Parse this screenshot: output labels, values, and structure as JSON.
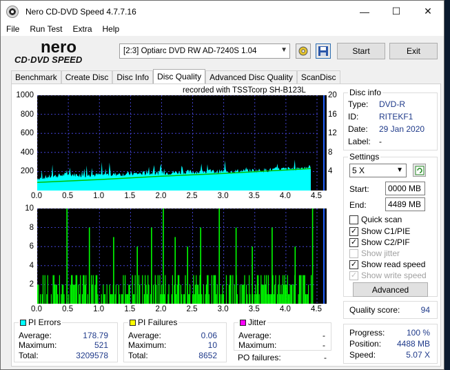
{
  "window": {
    "title": "Nero CD-DVD Speed 4.7.7.16"
  },
  "menu": [
    "File",
    "Run Test",
    "Extra",
    "Help"
  ],
  "toolbar": {
    "drive": "[2:3]  Optiarc DVD RW AD-7240S 1.04",
    "start_label": "Start",
    "exit_label": "Exit"
  },
  "tabs": [
    "Benchmark",
    "Create Disc",
    "Disc Info",
    "Disc Quality",
    "Advanced Disc Quality",
    "ScanDisc"
  ],
  "active_tab": "Disc Quality",
  "chart_top": {
    "caption": "recorded with TSSTcorp SH-B123L",
    "y_ticks": [
      "1000",
      "800",
      "600",
      "400",
      "200"
    ],
    "y2_ticks": [
      "20",
      "16",
      "12",
      "8",
      "4"
    ],
    "x_ticks": [
      "0.0",
      "0.5",
      "1.0",
      "1.5",
      "2.0",
      "2.5",
      "3.0",
      "3.5",
      "4.0",
      "4.5"
    ]
  },
  "chart_bottom": {
    "y_ticks": [
      "10",
      "8",
      "6",
      "4",
      "2"
    ],
    "x_ticks": [
      "0.0",
      "0.5",
      "1.0",
      "1.5",
      "2.0",
      "2.5",
      "3.0",
      "3.5",
      "4.0",
      "4.5"
    ]
  },
  "chart_data": [
    {
      "type": "area",
      "title": "recorded with TSSTcorp SH-B123L",
      "xlabel": "",
      "ylabel": "",
      "xlim": [
        0,
        4.5
      ],
      "ylim": [
        0,
        1000
      ],
      "y2lim": [
        0,
        20
      ],
      "series": [
        {
          "name": "PI Errors",
          "color": "#00ffff",
          "x": [
            0.0,
            0.25,
            0.5,
            0.75,
            1.0,
            1.5,
            2.0,
            2.5,
            3.0,
            3.5,
            4.0,
            4.3,
            4.4
          ],
          "values": [
            130,
            150,
            170,
            160,
            165,
            175,
            185,
            195,
            200,
            210,
            225,
            240,
            250
          ]
        },
        {
          "name": "Read speed",
          "color": "#00c000",
          "x": [
            0.0,
            1.0,
            2.0,
            3.0,
            4.0,
            4.4
          ],
          "values": [
            1.7,
            2.3,
            3.0,
            3.6,
            4.3,
            4.6
          ]
        }
      ]
    },
    {
      "type": "bar",
      "xlabel": "",
      "ylabel": "",
      "xlim": [
        0,
        4.5
      ],
      "ylim": [
        0,
        10
      ],
      "series": [
        {
          "name": "PI Failures",
          "color": "#00ff00",
          "typical_max": 3,
          "spikes_x": [
            0.47,
            0.83,
            1.22,
            1.6,
            1.83,
            2.02,
            2.21,
            2.41,
            2.62,
            2.92,
            3.19,
            3.45,
            3.77,
            4.14,
            4.42
          ],
          "spikes_y": [
            10,
            8,
            7,
            6,
            8,
            10,
            7,
            6,
            8,
            10,
            8,
            6,
            8,
            6,
            10
          ]
        }
      ]
    }
  ],
  "disc_info": {
    "title": "Disc info",
    "rows": [
      {
        "label": "Type:",
        "value": "DVD-R"
      },
      {
        "label": "ID:",
        "value": "RITEKF1"
      },
      {
        "label": "Date:",
        "value": "29 Jan 2020"
      },
      {
        "label": "Label:",
        "value": "-"
      }
    ]
  },
  "settings": {
    "title": "Settings",
    "speed": "5 X",
    "start_label": "Start:",
    "start_value": "0000 MB",
    "end_label": "End:",
    "end_value": "4489 MB",
    "checkboxes": [
      {
        "label": "Quick scan",
        "checked": false,
        "enabled": true
      },
      {
        "label": "Show C1/PIE",
        "checked": true,
        "enabled": true
      },
      {
        "label": "Show C2/PIF",
        "checked": true,
        "enabled": true
      },
      {
        "label": "Show jitter",
        "checked": false,
        "enabled": false
      },
      {
        "label": "Show read speed",
        "checked": true,
        "enabled": true
      },
      {
        "label": "Show write speed",
        "checked": true,
        "enabled": false
      }
    ],
    "advanced_label": "Advanced"
  },
  "quality": {
    "label": "Quality score:",
    "value": "94"
  },
  "progress": {
    "rows": [
      {
        "label": "Progress:",
        "value": "100 %"
      },
      {
        "label": "Position:",
        "value": "4488 MB"
      },
      {
        "label": "Speed:",
        "value": "5.07 X"
      }
    ]
  },
  "stats": {
    "pi_errors": {
      "title": "PI Errors",
      "color": "#00ffff",
      "avg": "178.79",
      "max": "521",
      "total": "3209578"
    },
    "pi_failures": {
      "title": "PI Failures",
      "color": "#ffff00",
      "avg": "0.06",
      "max": "10",
      "total": "8652"
    },
    "jitter": {
      "title": "Jitter",
      "color": "#ff00ff",
      "avg": "-",
      "max": "-"
    },
    "labels": {
      "avg": "Average:",
      "max": "Maximum:",
      "total": "Total:",
      "po": "PO failures:"
    },
    "po_value": "-"
  }
}
